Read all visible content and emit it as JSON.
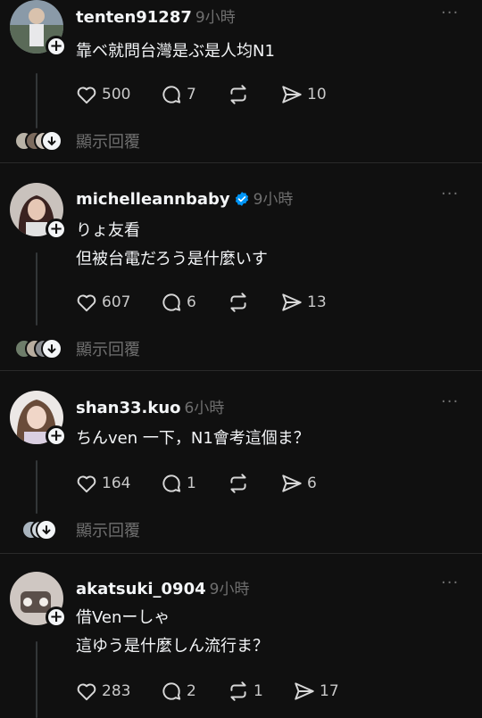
{
  "posts": [
    {
      "username": "tenten91287",
      "time": "9小時",
      "verified": false,
      "lines": [
        "靠ベ就問台灣是ぶ是人均N1"
      ],
      "likes": "500",
      "comments": "7",
      "reposts": "",
      "shares": "10",
      "show_replies": "顯示回覆"
    },
    {
      "username": "michelleannbaby",
      "time": "9小時",
      "verified": true,
      "lines": [
        "りょ友看",
        "但被台電だろう是什麼いす"
      ],
      "likes": "607",
      "comments": "6",
      "reposts": "",
      "shares": "13",
      "show_replies": "顯示回覆"
    },
    {
      "username": "shan33.kuo",
      "time": "6小時",
      "verified": false,
      "lines": [
        "ちんven 一下，N1會考這個ま？"
      ],
      "likes": "164",
      "comments": "1",
      "reposts": "",
      "shares": "6",
      "show_replies": "顯示回覆"
    },
    {
      "username": "akatsuki_0904",
      "time": "9小時",
      "verified": false,
      "lines": [
        "借Venーしゃ",
        "這ゆう是什麼しん流行ま？"
      ],
      "likes": "283",
      "comments": "2",
      "reposts": "1",
      "shares": "17"
    }
  ],
  "more_glyph": "···",
  "colors": {
    "background": "#101010",
    "text": "#f3f5f7",
    "muted": "#6f6f6f",
    "verified": "#0095f6"
  },
  "icons": [
    "heart-icon",
    "comment-icon",
    "repost-icon",
    "share-icon",
    "more-icon",
    "verified-icon",
    "plus-icon",
    "chevron-down-icon"
  ]
}
